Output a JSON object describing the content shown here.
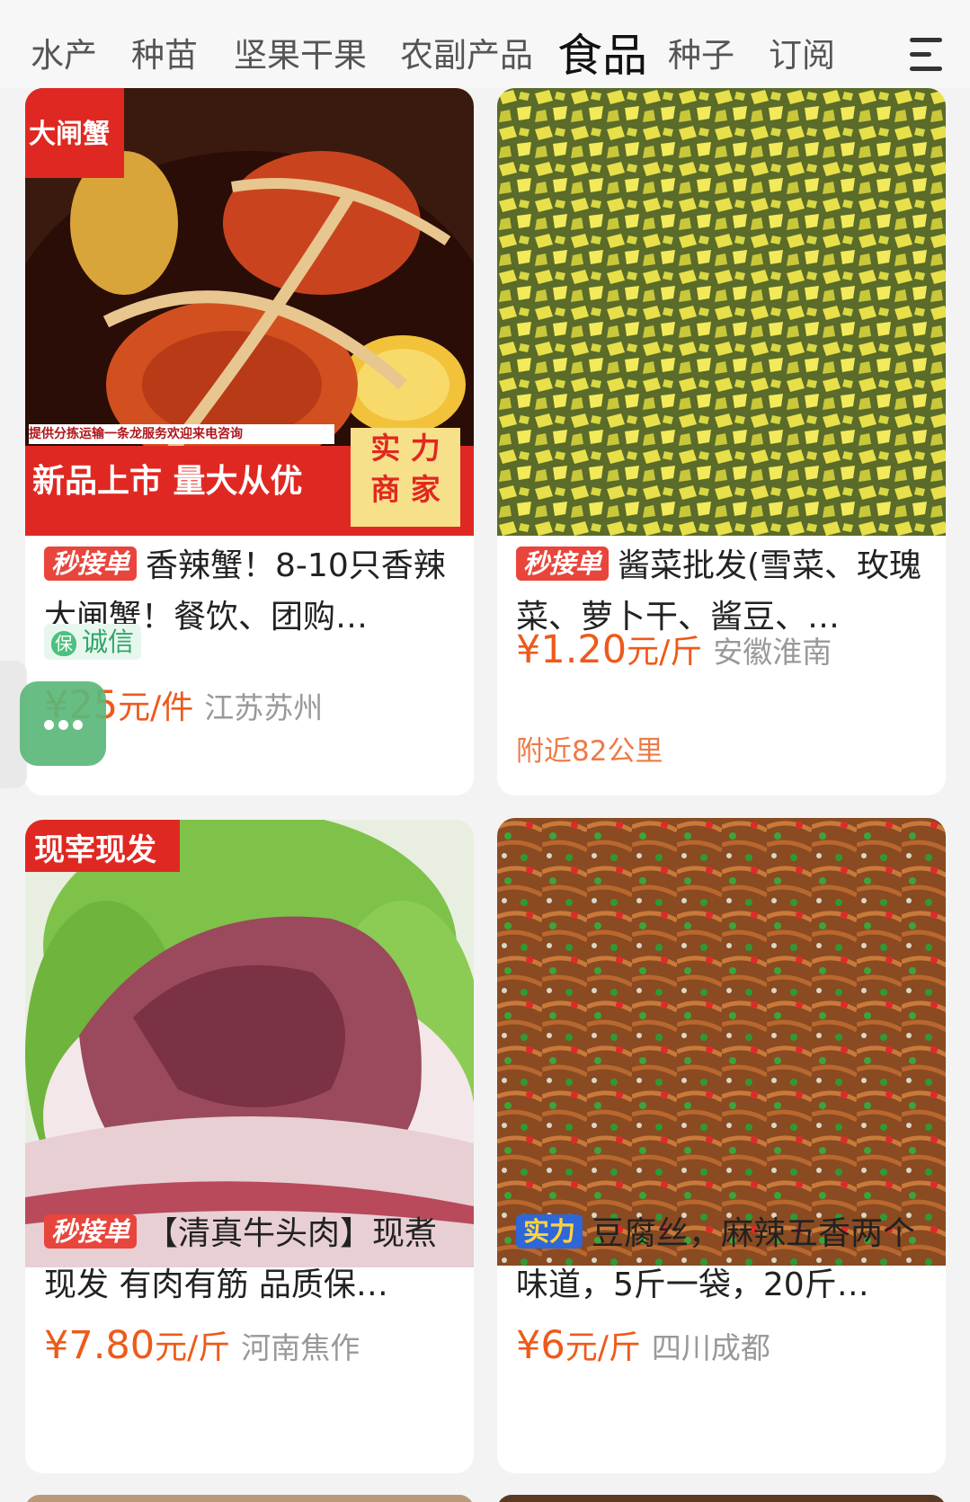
{
  "tabs": [
    {
      "label": "水产"
    },
    {
      "label": "种苗"
    },
    {
      "label": "坚果干果"
    },
    {
      "label": "农副产品"
    },
    {
      "label": "食品",
      "active": true
    },
    {
      "label": "种子"
    },
    {
      "label": "订阅"
    }
  ],
  "products": [
    {
      "image_tag": "大闸蟹",
      "image_subline": "提供分拣运输一条龙服务欢迎来电咨询",
      "image_banner": "新品上市 量大从优",
      "image_stamp_line1": "实 力",
      "image_stamp_line2": "商 家",
      "badge": "秒接单",
      "title": "香辣蟹！8-10只香辣大闸蟹！餐饮、团购…",
      "trust": "诚信",
      "price": "¥25",
      "unit": "元/件",
      "location": "江苏苏州"
    },
    {
      "badge": "秒接单",
      "title": "酱菜批发(雪菜、玫瑰菜、萝卜干、酱豆、…",
      "price": "¥1.20",
      "unit": "元/斤",
      "location": "安徽淮南",
      "distance": "附近82公里"
    },
    {
      "image_tag": "现宰现发",
      "badge": "秒接单",
      "title": "【清真牛头肉】现煮现发 有肉有筋 品质保…",
      "price": "¥7.80",
      "unit": "元/斤",
      "location": "河南焦作"
    },
    {
      "badge": "实力",
      "title": "豆腐丝，麻辣五香两个味道，5斤一袋，20斤…",
      "price": "¥6",
      "unit": "元/斤",
      "location": "四川成都"
    }
  ],
  "colors": {
    "price": "#ee5a1a",
    "badge_red": "#e8453c",
    "badge_blue": "#2f66d8",
    "trust_green": "#2ea66b",
    "float_button": "#5cb87a"
  },
  "icons": {
    "menu": "hamburger-menu-icon",
    "float": "more-dots-icon",
    "trust": "shield-icon"
  }
}
